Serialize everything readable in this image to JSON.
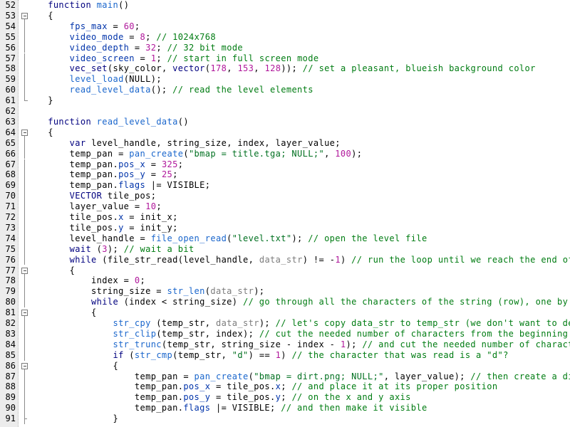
{
  "editor": {
    "title": "code-editor",
    "language": "Lite-C",
    "first_line": 52,
    "last_line": 91,
    "gutter_bg": "#ececec",
    "page_bg": "#ffffff",
    "colors": {
      "keyword": "#00007f",
      "function": "#1a66cc",
      "member": "#0033aa",
      "number": "#b0179b",
      "string": "#007020",
      "comment": "#007c12",
      "dim_identifier": "#7c7c7c",
      "plain": "#000000",
      "fold_line": "#8c8c8c"
    }
  },
  "lines": [
    {
      "n": 52,
      "fold": "none",
      "tokens": [
        {
          "t": "plain",
          "v": "  "
        },
        {
          "t": "keyword",
          "v": "function"
        },
        {
          "t": "plain",
          "v": " "
        },
        {
          "t": "func",
          "v": "main"
        },
        {
          "t": "plain",
          "v": "()"
        }
      ]
    },
    {
      "n": 53,
      "fold": "box",
      "tokens": [
        {
          "t": "plain",
          "v": "  {"
        }
      ]
    },
    {
      "n": 54,
      "fold": "line",
      "tokens": [
        {
          "t": "plain",
          "v": "      "
        },
        {
          "t": "member",
          "v": "fps_max"
        },
        {
          "t": "plain",
          "v": " = "
        },
        {
          "t": "number",
          "v": "60"
        },
        {
          "t": "plain",
          "v": ";"
        }
      ]
    },
    {
      "n": 55,
      "fold": "line",
      "tokens": [
        {
          "t": "plain",
          "v": "      "
        },
        {
          "t": "member",
          "v": "video_mode"
        },
        {
          "t": "plain",
          "v": " = "
        },
        {
          "t": "number",
          "v": "8"
        },
        {
          "t": "plain",
          "v": "; "
        },
        {
          "t": "comment",
          "v": "// 1024x768"
        }
      ]
    },
    {
      "n": 56,
      "fold": "line",
      "tokens": [
        {
          "t": "plain",
          "v": "      "
        },
        {
          "t": "member",
          "v": "video_depth"
        },
        {
          "t": "plain",
          "v": " = "
        },
        {
          "t": "number",
          "v": "32"
        },
        {
          "t": "plain",
          "v": "; "
        },
        {
          "t": "comment",
          "v": "// 32 bit mode"
        }
      ]
    },
    {
      "n": 57,
      "fold": "line",
      "tokens": [
        {
          "t": "plain",
          "v": "      "
        },
        {
          "t": "member",
          "v": "video_screen"
        },
        {
          "t": "plain",
          "v": " = "
        },
        {
          "t": "number",
          "v": "1"
        },
        {
          "t": "plain",
          "v": "; "
        },
        {
          "t": "comment",
          "v": "// start in full screen mode"
        }
      ]
    },
    {
      "n": 58,
      "fold": "line",
      "tokens": [
        {
          "t": "plain",
          "v": "      "
        },
        {
          "t": "keyword",
          "v": "vec_set"
        },
        {
          "t": "plain",
          "v": "("
        },
        {
          "t": "plain",
          "v": "sky_color"
        },
        {
          "t": "plain",
          "v": ", "
        },
        {
          "t": "keyword",
          "v": "vector"
        },
        {
          "t": "plain",
          "v": "("
        },
        {
          "t": "number",
          "v": "178"
        },
        {
          "t": "plain",
          "v": ", "
        },
        {
          "t": "number",
          "v": "153"
        },
        {
          "t": "plain",
          "v": ", "
        },
        {
          "t": "number",
          "v": "128"
        },
        {
          "t": "plain",
          "v": ")); "
        },
        {
          "t": "comment",
          "v": "// set a pleasant, blueish background color"
        }
      ]
    },
    {
      "n": 59,
      "fold": "line",
      "tokens": [
        {
          "t": "plain",
          "v": "      "
        },
        {
          "t": "func",
          "v": "level_load"
        },
        {
          "t": "plain",
          "v": "("
        },
        {
          "t": "plain",
          "v": "NULL"
        },
        {
          "t": "plain",
          "v": ");"
        }
      ]
    },
    {
      "n": 60,
      "fold": "line",
      "tokens": [
        {
          "t": "plain",
          "v": "      "
        },
        {
          "t": "func",
          "v": "read_level_data"
        },
        {
          "t": "plain",
          "v": "(); "
        },
        {
          "t": "comment",
          "v": "// read the level elements"
        }
      ]
    },
    {
      "n": 61,
      "fold": "end",
      "tokens": [
        {
          "t": "plain",
          "v": "  }"
        }
      ]
    },
    {
      "n": 62,
      "fold": "none",
      "tokens": [
        {
          "t": "plain",
          "v": ""
        }
      ]
    },
    {
      "n": 63,
      "fold": "none",
      "tokens": [
        {
          "t": "plain",
          "v": "  "
        },
        {
          "t": "keyword",
          "v": "function"
        },
        {
          "t": "plain",
          "v": " "
        },
        {
          "t": "func",
          "v": "read_level_data"
        },
        {
          "t": "plain",
          "v": "()"
        }
      ]
    },
    {
      "n": 64,
      "fold": "box",
      "tokens": [
        {
          "t": "plain",
          "v": "  {"
        }
      ]
    },
    {
      "n": 65,
      "fold": "line",
      "tokens": [
        {
          "t": "plain",
          "v": "      "
        },
        {
          "t": "keyword",
          "v": "var"
        },
        {
          "t": "plain",
          "v": " level_handle, string_size, index, layer_value;"
        }
      ]
    },
    {
      "n": 66,
      "fold": "line",
      "tokens": [
        {
          "t": "plain",
          "v": "      temp_pan = "
        },
        {
          "t": "func",
          "v": "pan_create"
        },
        {
          "t": "plain",
          "v": "("
        },
        {
          "t": "string",
          "v": "\"bmap = title.tga; NULL;\""
        },
        {
          "t": "plain",
          "v": ", "
        },
        {
          "t": "number",
          "v": "100"
        },
        {
          "t": "plain",
          "v": ");"
        }
      ]
    },
    {
      "n": 67,
      "fold": "line",
      "tokens": [
        {
          "t": "plain",
          "v": "      temp_pan."
        },
        {
          "t": "member",
          "v": "pos_x"
        },
        {
          "t": "plain",
          "v": " = "
        },
        {
          "t": "number",
          "v": "325"
        },
        {
          "t": "plain",
          "v": ";"
        }
      ]
    },
    {
      "n": 68,
      "fold": "line",
      "tokens": [
        {
          "t": "plain",
          "v": "      temp_pan."
        },
        {
          "t": "member",
          "v": "pos_y"
        },
        {
          "t": "plain",
          "v": " = "
        },
        {
          "t": "number",
          "v": "25"
        },
        {
          "t": "plain",
          "v": ";"
        }
      ]
    },
    {
      "n": 69,
      "fold": "line",
      "tokens": [
        {
          "t": "plain",
          "v": "      temp_pan."
        },
        {
          "t": "member",
          "v": "flags"
        },
        {
          "t": "plain",
          "v": " |= VISIBLE;"
        }
      ]
    },
    {
      "n": 70,
      "fold": "line",
      "tokens": [
        {
          "t": "plain",
          "v": "      "
        },
        {
          "t": "keyword",
          "v": "VECTOR"
        },
        {
          "t": "plain",
          "v": " tile_pos;"
        }
      ]
    },
    {
      "n": 71,
      "fold": "line",
      "tokens": [
        {
          "t": "plain",
          "v": "      layer_value = "
        },
        {
          "t": "number",
          "v": "10"
        },
        {
          "t": "plain",
          "v": ";"
        }
      ]
    },
    {
      "n": 72,
      "fold": "line",
      "tokens": [
        {
          "t": "plain",
          "v": "      tile_pos."
        },
        {
          "t": "member",
          "v": "x"
        },
        {
          "t": "plain",
          "v": " = init_x;"
        }
      ]
    },
    {
      "n": 73,
      "fold": "line",
      "tokens": [
        {
          "t": "plain",
          "v": "      tile_pos."
        },
        {
          "t": "member",
          "v": "y"
        },
        {
          "t": "plain",
          "v": " = init_y;"
        }
      ]
    },
    {
      "n": 74,
      "fold": "line",
      "tokens": [
        {
          "t": "plain",
          "v": "      level_handle = "
        },
        {
          "t": "func",
          "v": "file_open_read"
        },
        {
          "t": "plain",
          "v": "("
        },
        {
          "t": "string",
          "v": "\"level.txt\""
        },
        {
          "t": "plain",
          "v": "); "
        },
        {
          "t": "comment",
          "v": "// open the level file"
        }
      ]
    },
    {
      "n": 75,
      "fold": "line",
      "tokens": [
        {
          "t": "plain",
          "v": "      "
        },
        {
          "t": "keyword",
          "v": "wait"
        },
        {
          "t": "plain",
          "v": " ("
        },
        {
          "t": "number",
          "v": "3"
        },
        {
          "t": "plain",
          "v": "); "
        },
        {
          "t": "comment",
          "v": "// wait a bit"
        }
      ]
    },
    {
      "n": 76,
      "fold": "line",
      "tokens": [
        {
          "t": "plain",
          "v": "      "
        },
        {
          "t": "keyword",
          "v": "while"
        },
        {
          "t": "plain",
          "v": " ("
        },
        {
          "t": "plain",
          "v": "file_str_read"
        },
        {
          "t": "plain",
          "v": "(level_handle, "
        },
        {
          "t": "dim",
          "v": "data_str"
        },
        {
          "t": "plain",
          "v": ") != -"
        },
        {
          "t": "number",
          "v": "1"
        },
        {
          "t": "plain",
          "v": ") "
        },
        {
          "t": "comment",
          "v": "// run the loop until we reach the end of the file"
        }
      ]
    },
    {
      "n": 77,
      "fold": "box",
      "tokens": [
        {
          "t": "plain",
          "v": "      {"
        }
      ]
    },
    {
      "n": 78,
      "fold": "line",
      "tokens": [
        {
          "t": "plain",
          "v": "          index = "
        },
        {
          "t": "number",
          "v": "0"
        },
        {
          "t": "plain",
          "v": ";"
        }
      ]
    },
    {
      "n": 79,
      "fold": "line",
      "tokens": [
        {
          "t": "plain",
          "v": "          string_size = "
        },
        {
          "t": "func",
          "v": "str_len"
        },
        {
          "t": "plain",
          "v": "("
        },
        {
          "t": "dim",
          "v": "data_str"
        },
        {
          "t": "plain",
          "v": ");"
        }
      ]
    },
    {
      "n": 80,
      "fold": "line",
      "tokens": [
        {
          "t": "plain",
          "v": "          "
        },
        {
          "t": "keyword",
          "v": "while"
        },
        {
          "t": "plain",
          "v": " (index < string_size) "
        },
        {
          "t": "comment",
          "v": "// go through all the characters of the string (row), one by one"
        }
      ]
    },
    {
      "n": 81,
      "fold": "box",
      "tokens": [
        {
          "t": "plain",
          "v": "          {"
        }
      ]
    },
    {
      "n": 82,
      "fold": "line",
      "tokens": [
        {
          "t": "plain",
          "v": "              "
        },
        {
          "t": "func",
          "v": "str_cpy"
        },
        {
          "t": "plain",
          "v": " (temp_str, "
        },
        {
          "t": "dim",
          "v": "data_str"
        },
        {
          "t": "plain",
          "v": "); "
        },
        {
          "t": "comment",
          "v": "// let's copy data_str to temp_str (we don't want to destroy it)"
        }
      ]
    },
    {
      "n": 83,
      "fold": "line",
      "tokens": [
        {
          "t": "plain",
          "v": "              "
        },
        {
          "t": "func",
          "v": "str_clip"
        },
        {
          "t": "plain",
          "v": "(temp_str, index); "
        },
        {
          "t": "comment",
          "v": "// cut the needed number of characters from the beginning of the string"
        }
      ]
    },
    {
      "n": 84,
      "fold": "line",
      "tokens": [
        {
          "t": "plain",
          "v": "              "
        },
        {
          "t": "func",
          "v": "str_trunc"
        },
        {
          "t": "plain",
          "v": "(temp_str, string_size - index - "
        },
        {
          "t": "number",
          "v": "1"
        },
        {
          "t": "plain",
          "v": "); "
        },
        {
          "t": "comment",
          "v": "// and cut the needed number of characters from the end"
        }
      ]
    },
    {
      "n": 85,
      "fold": "line",
      "tokens": [
        {
          "t": "plain",
          "v": "              "
        },
        {
          "t": "keyword",
          "v": "if"
        },
        {
          "t": "plain",
          "v": " ("
        },
        {
          "t": "func",
          "v": "str_cmp"
        },
        {
          "t": "plain",
          "v": "(temp_str, "
        },
        {
          "t": "string",
          "v": "\"d\""
        },
        {
          "t": "plain",
          "v": ") == "
        },
        {
          "t": "number",
          "v": "1"
        },
        {
          "t": "plain",
          "v": ") "
        },
        {
          "t": "comment",
          "v": "// the character that was read is a \"d\"?"
        }
      ]
    },
    {
      "n": 86,
      "fold": "box",
      "tokens": [
        {
          "t": "plain",
          "v": "              {"
        }
      ]
    },
    {
      "n": 87,
      "fold": "line",
      "tokens": [
        {
          "t": "plain",
          "v": "                  temp_pan = "
        },
        {
          "t": "func",
          "v": "pan_create"
        },
        {
          "t": "plain",
          "v": "("
        },
        {
          "t": "string",
          "v": "\"bmap = dirt.png; NULL;\""
        },
        {
          "t": "plain",
          "v": ", layer_value); "
        },
        {
          "t": "comment",
          "v": "// then create a dirt panel"
        }
      ]
    },
    {
      "n": 88,
      "fold": "line",
      "tokens": [
        {
          "t": "plain",
          "v": "                  temp_pan."
        },
        {
          "t": "member",
          "v": "pos_x"
        },
        {
          "t": "plain",
          "v": " = tile_pos."
        },
        {
          "t": "member",
          "v": "x"
        },
        {
          "t": "plain",
          "v": "; "
        },
        {
          "t": "comment",
          "v": "// and place it at its proper position"
        }
      ]
    },
    {
      "n": 89,
      "fold": "line",
      "tokens": [
        {
          "t": "plain",
          "v": "                  temp_pan."
        },
        {
          "t": "member",
          "v": "pos_y"
        },
        {
          "t": "plain",
          "v": " = tile_pos."
        },
        {
          "t": "member",
          "v": "y"
        },
        {
          "t": "plain",
          "v": "; "
        },
        {
          "t": "comment",
          "v": "// on the x and y axis"
        }
      ]
    },
    {
      "n": 90,
      "fold": "line",
      "tokens": [
        {
          "t": "plain",
          "v": "                  temp_pan."
        },
        {
          "t": "member",
          "v": "flags"
        },
        {
          "t": "plain",
          "v": " |= VISIBLE; "
        },
        {
          "t": "comment",
          "v": "// and then make it visible"
        }
      ]
    },
    {
      "n": 91,
      "fold": "tick",
      "tokens": [
        {
          "t": "plain",
          "v": "              }"
        }
      ]
    }
  ]
}
